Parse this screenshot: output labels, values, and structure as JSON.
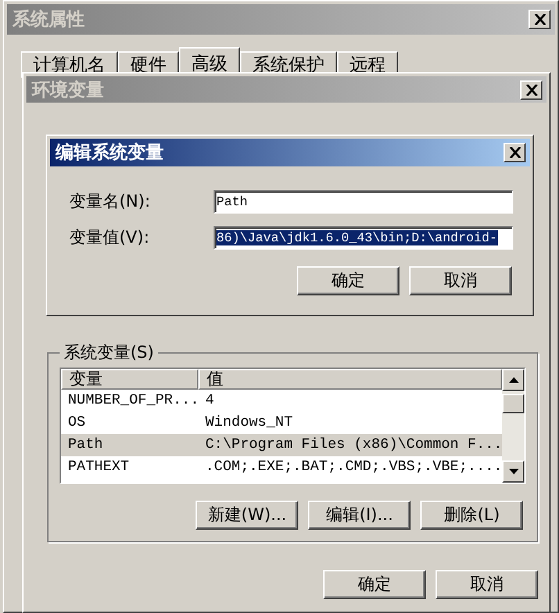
{
  "system_properties": {
    "title": "系统属性",
    "active": false,
    "tabs": [
      {
        "label": "计算机名",
        "selected": false
      },
      {
        "label": "硬件",
        "selected": false
      },
      {
        "label": "高级",
        "selected": true
      },
      {
        "label": "系统保护",
        "selected": false
      },
      {
        "label": "远程",
        "selected": false
      }
    ]
  },
  "environment_variables": {
    "title": "环境变量",
    "active": false,
    "system_variables": {
      "label": "系统变量(S)",
      "columns": [
        "变量",
        "值"
      ],
      "rows": [
        {
          "name": "NUMBER_OF_PR...",
          "value": "4",
          "selected": false
        },
        {
          "name": "OS",
          "value": "Windows_NT",
          "selected": false
        },
        {
          "name": "Path",
          "value": "C:\\Program Files (x86)\\Common F...",
          "selected": true
        },
        {
          "name": "PATHEXT",
          "value": ".COM;.EXE;.BAT;.CMD;.VBS;.VBE;....",
          "selected": false
        }
      ]
    },
    "list_buttons": [
      "新建(W)...",
      "编辑(I)...",
      "删除(L)"
    ],
    "buttons": [
      "确定",
      "取消"
    ]
  },
  "edit_dialog": {
    "title": "编辑系统变量",
    "active": true,
    "fields": [
      {
        "label": "变量名(N):",
        "value": "Path",
        "selected": false
      },
      {
        "label": "变量值(V):",
        "value": "86)\\Java\\jdk1.6.0_43\\bin;D:\\android-",
        "selected": true
      }
    ],
    "buttons": [
      "确定",
      "取消"
    ]
  }
}
